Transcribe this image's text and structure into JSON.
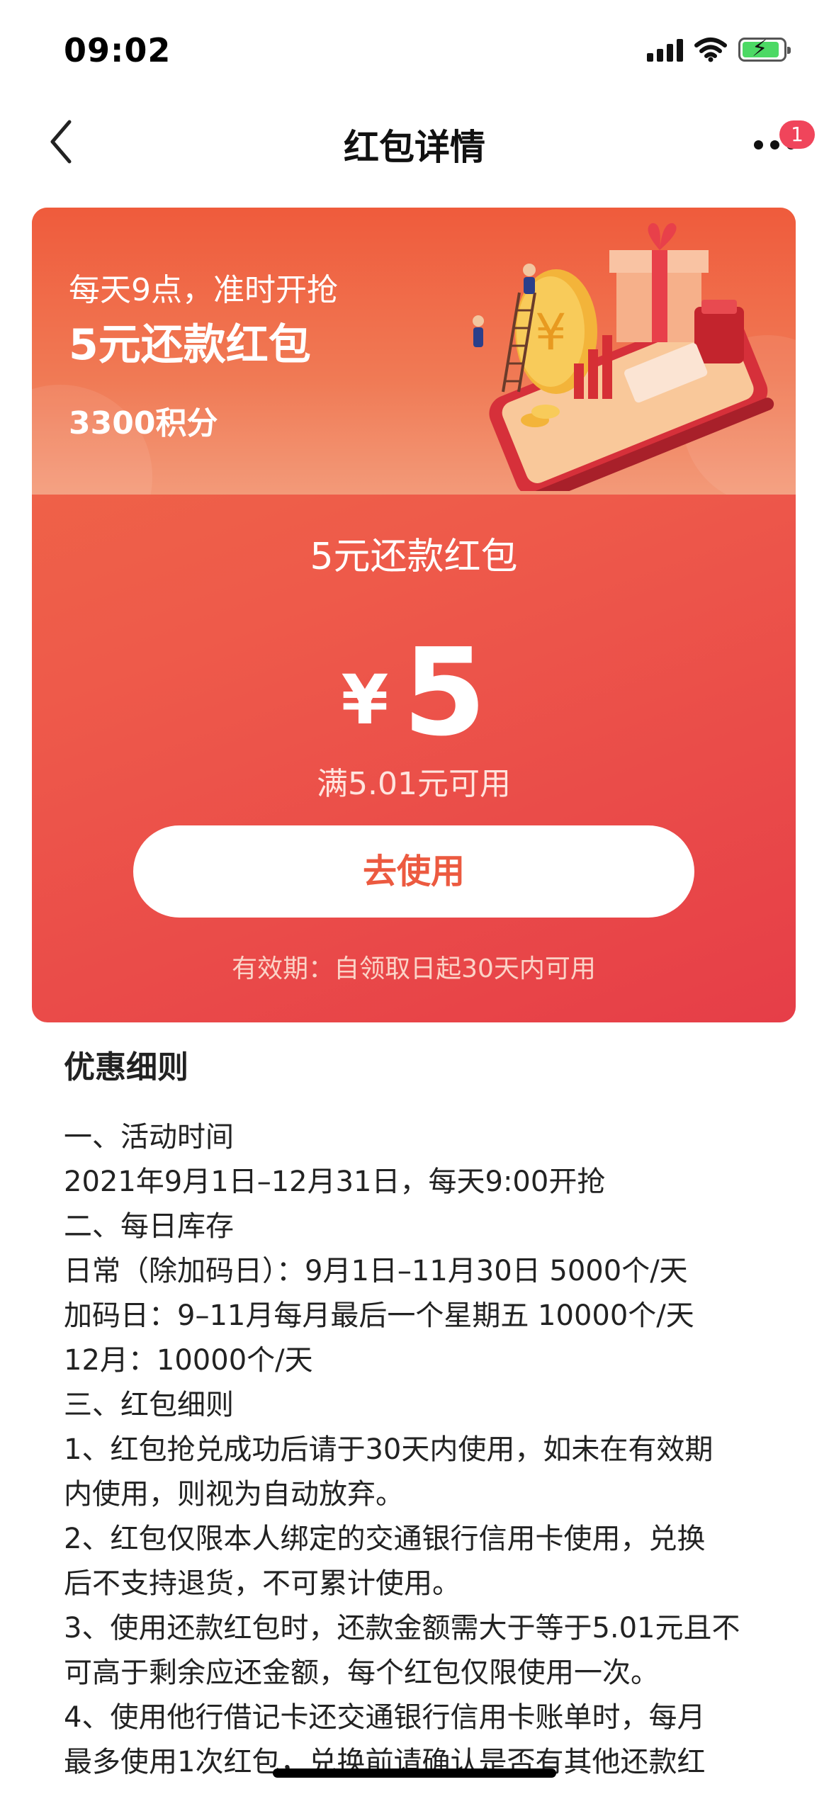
{
  "status_bar": {
    "time": "09:02"
  },
  "nav": {
    "title": "红包详情",
    "badge_count": "1"
  },
  "banner": {
    "line1": "每天9点，准时开抢",
    "line2": "5元还款红包",
    "points": "3300积分"
  },
  "coupon": {
    "name": "5元还款红包",
    "currency": "¥",
    "amount": "5",
    "threshold": "满5.01元可用",
    "use_button": "去使用",
    "validity": "有效期：自领取日起30天内可用"
  },
  "rules": {
    "title": "优惠细则",
    "lines": [
      "一、活动时间",
      "2021年9月1日–12月31日，每天9:00开抢",
      "二、每日库存",
      "日常（除加码日）：9月1日–11月30日 5000个/天",
      "加码日：9–11月每月最后一个星期五 10000个/天",
      "12月：10000个/天",
      "三、红包细则",
      "1、红包抢兑成功后请于30天内使用，如未在有效期",
      "内使用，则视为自动放弃。",
      "2、红包仅限本人绑定的交通银行信用卡使用，兑换",
      "后不支持退货，不可累计使用。",
      "3、使用还款红包时，还款金额需大于等于5.01元且不",
      "可高于剩余应还金额，每个红包仅限使用一次。",
      "4、使用他行借记卡还交通银行信用卡账单时，每月",
      "最多使用1次红包，兑换前请确认是否有其他还款红"
    ]
  },
  "colors": {
    "card_top": "#f06b45",
    "card_bottom": "#e63e48",
    "button_text": "#ec5a40",
    "badge": "#f0455b"
  },
  "icons": [
    "signal-icon",
    "wifi-icon",
    "battery-charging-icon",
    "back-chevron-icon",
    "more-icon"
  ]
}
